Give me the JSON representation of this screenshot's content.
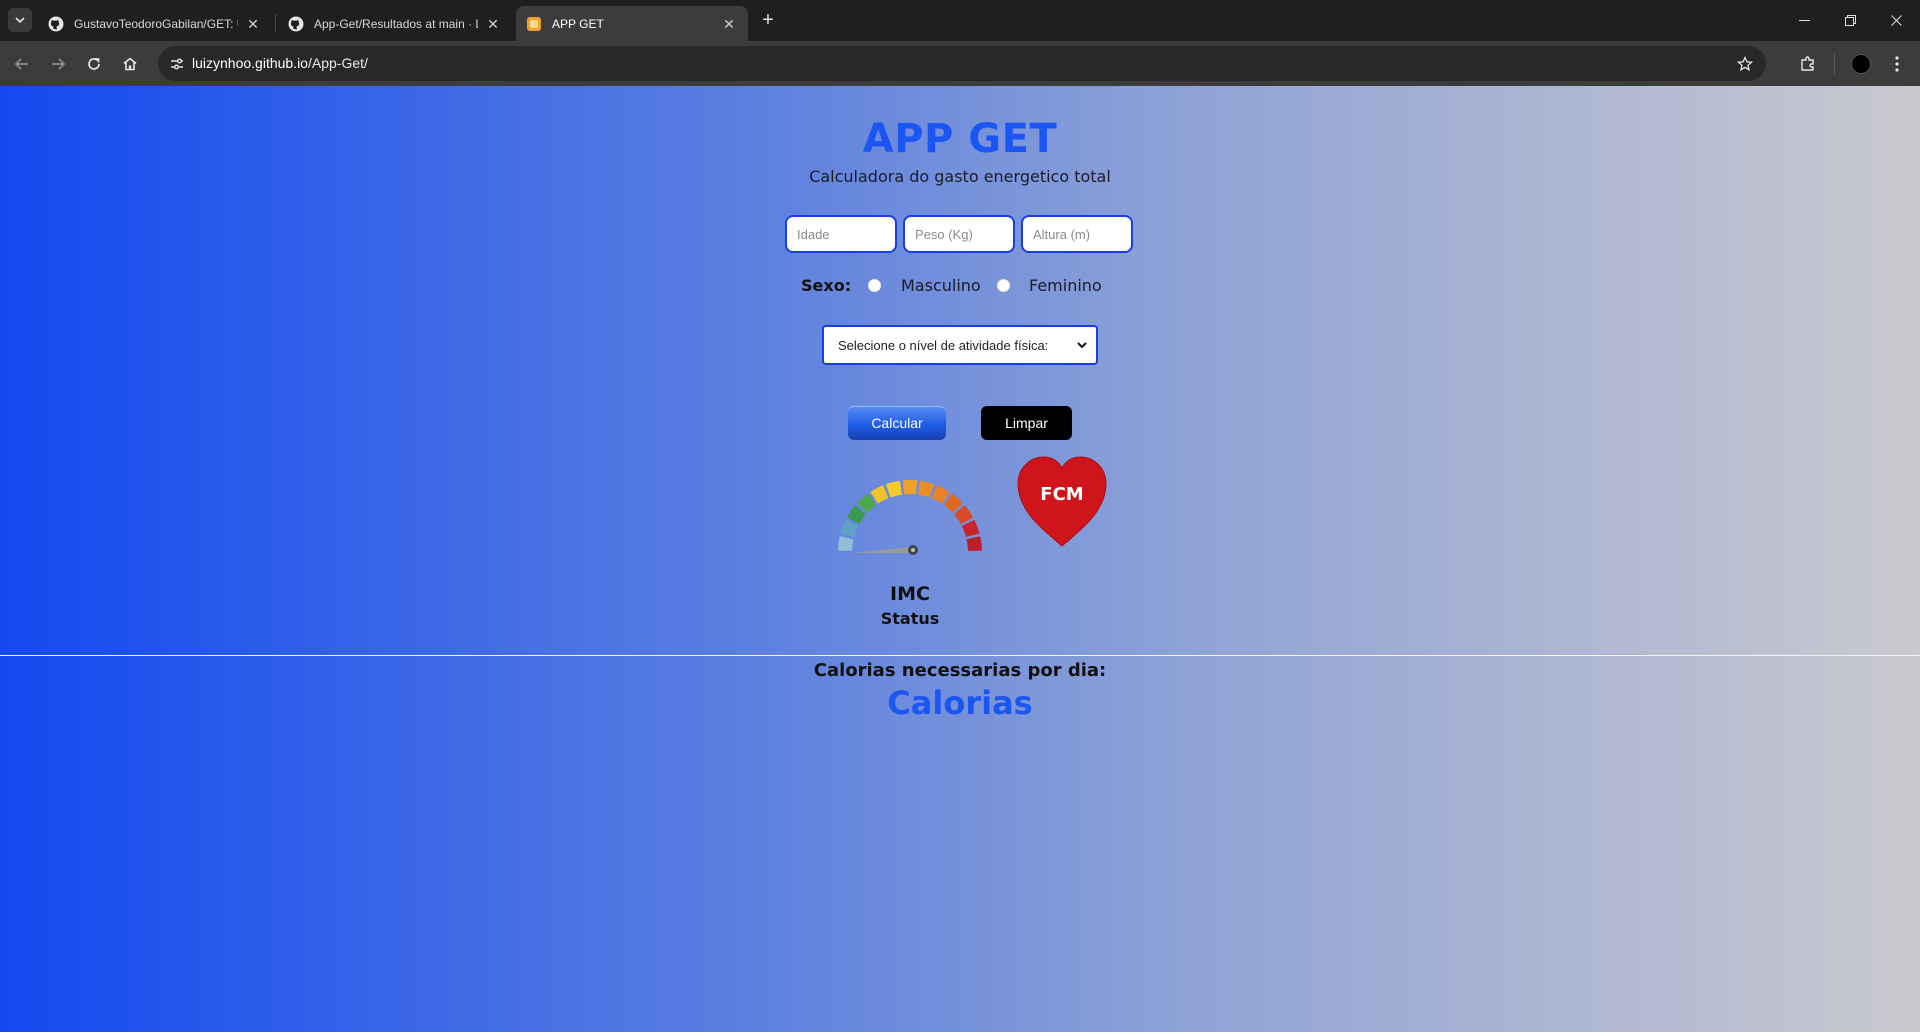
{
  "browser": {
    "tabs": [
      {
        "title": "GustavoTeodoroGabilan/GET: U",
        "favicon": "github-icon",
        "active": false
      },
      {
        "title": "App-Get/Resultados at main · L",
        "favicon": "github-icon",
        "active": false
      },
      {
        "title": "APP GET",
        "favicon": "app-get-favicon",
        "active": true
      }
    ],
    "url_host": "luizynhoo.github.io",
    "url_path": "/App-Get/",
    "icons": {
      "back": "back-arrow-icon",
      "forward": "forward-arrow-icon",
      "reload": "reload-icon",
      "home": "home-icon",
      "bookmark": "star-icon",
      "extensions": "puzzle-icon"
    }
  },
  "page": {
    "title": "APP GET",
    "subtitle": "Calculadora do gasto energetico total",
    "inputs": {
      "idade_placeholder": "Idade",
      "peso_placeholder": "Peso (Kg)",
      "altura_placeholder": "Altura (m)"
    },
    "sexo": {
      "label": "Sexo:",
      "option_masculino": "Masculino",
      "option_feminino": "Feminino"
    },
    "atividade_select": "Selecione o nível de atividade física:",
    "buttons": {
      "calcular": "Calcular",
      "limpar": "Limpar"
    },
    "imc": {
      "label": "IMC",
      "status": "Status"
    },
    "fcm_label": "FCM",
    "calorias": {
      "label": "Calorias necessarias por dia:",
      "value": "Calorias"
    }
  },
  "colors": {
    "accent": "#1b56f2",
    "input_border": "#1a3fe0",
    "heart": "#d0141c",
    "gauge_segments": [
      "#8fbfd6",
      "#5ea3c6",
      "#3a9a4f",
      "#4aa84d",
      "#f0c429",
      "#f5cc2a",
      "#eea229",
      "#e98f27",
      "#e7812a",
      "#de6a22",
      "#d84a23",
      "#c8262a",
      "#b81f28"
    ]
  }
}
